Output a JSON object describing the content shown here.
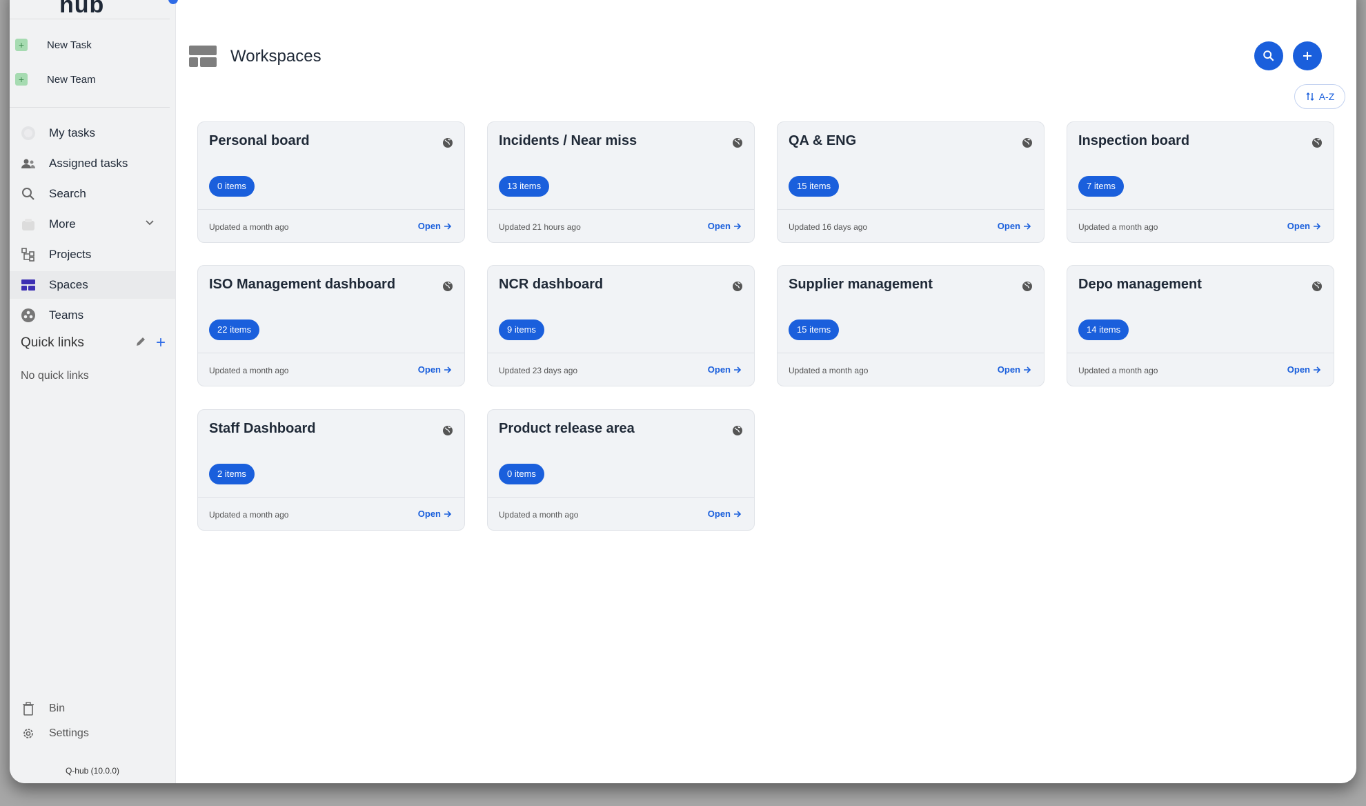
{
  "app": {
    "logo": "hub",
    "version": "Q-hub (10.0.0)"
  },
  "sidebar": {
    "new_items": [
      {
        "label": "New Task"
      },
      {
        "label": "New Team"
      }
    ],
    "nav": [
      {
        "label": "My tasks",
        "icon": "my-tasks-icon"
      },
      {
        "label": "Assigned tasks",
        "icon": "assigned-tasks-icon"
      },
      {
        "label": "Search",
        "icon": "search-icon"
      },
      {
        "label": "More",
        "icon": "more-icon"
      },
      {
        "label": "Projects",
        "icon": "projects-icon"
      },
      {
        "label": "Spaces",
        "icon": "spaces-icon",
        "active": true
      },
      {
        "label": "Teams",
        "icon": "teams-icon"
      }
    ],
    "quick_links": {
      "title": "Quick links",
      "empty": "No quick links"
    },
    "bottom": [
      {
        "label": "Bin",
        "icon": "bin-icon"
      },
      {
        "label": "Settings",
        "icon": "gear-icon"
      }
    ]
  },
  "header": {
    "title": "Workspaces",
    "sort_label": "A-Z"
  },
  "colors": {
    "accent": "#1a5fdc",
    "new_green": "#a6dbb1"
  },
  "open_label": "Open",
  "workspaces": [
    {
      "title": "Personal board",
      "items": "0 items",
      "updated": "Updated a month ago"
    },
    {
      "title": "Incidents / Near miss",
      "items": "13 items",
      "updated": "Updated 21 hours ago"
    },
    {
      "title": "QA & ENG",
      "items": "15 items",
      "updated": "Updated 16 days ago"
    },
    {
      "title": "Inspection board",
      "items": "7 items",
      "updated": "Updated a month ago"
    },
    {
      "title": "ISO Management dashboard",
      "items": "22 items",
      "updated": "Updated a month ago"
    },
    {
      "title": "NCR dashboard",
      "items": "9 items",
      "updated": "Updated 23 days ago"
    },
    {
      "title": "Supplier management",
      "items": "15 items",
      "updated": "Updated a month ago"
    },
    {
      "title": "Depo management",
      "items": "14 items",
      "updated": "Updated a month ago"
    },
    {
      "title": "Staff Dashboard",
      "items": "2 items",
      "updated": "Updated a month ago"
    },
    {
      "title": "Product release area",
      "items": "0 items",
      "updated": "Updated a month ago"
    }
  ]
}
